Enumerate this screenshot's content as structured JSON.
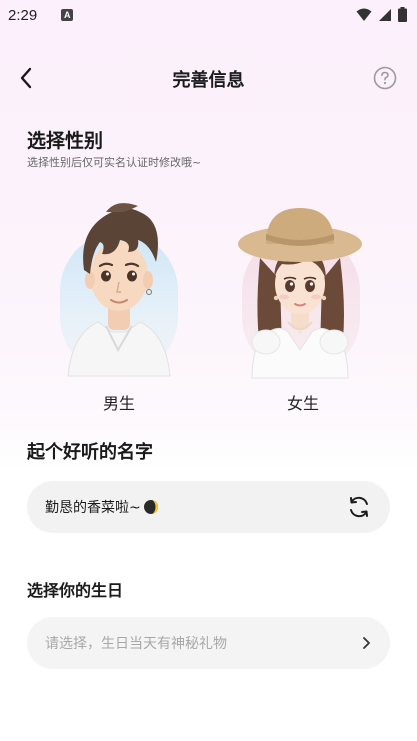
{
  "status_bar": {
    "time": "2:29",
    "icons": [
      "a-notification-icon",
      "wifi-icon",
      "signal-icon",
      "battery-icon"
    ]
  },
  "nav": {
    "title": "完善信息",
    "back_icon": "back-arrow-icon",
    "help_icon": "question-circle-icon"
  },
  "gender": {
    "title": "选择性别",
    "hint": "选择性别后仅可实名认证时修改哦~",
    "options": [
      {
        "label": "男生",
        "avatar": "male-avatar"
      },
      {
        "label": "女生",
        "avatar": "female-avatar"
      }
    ]
  },
  "name": {
    "title": "起个好听的名字",
    "value": "勤恳的香菜啦~",
    "emoji": "crescent-moon-emoji",
    "refresh_icon": "refresh-icon"
  },
  "birthday": {
    "title": "选择你的生日",
    "placeholder": "请选择，生日当天有神秘礼物",
    "chevron_icon": "chevron-right-icon"
  },
  "colors": {
    "background_top": "#fbf0fb",
    "field_background": "#f2f2f2",
    "placeholder_text": "#a8a8a8"
  }
}
